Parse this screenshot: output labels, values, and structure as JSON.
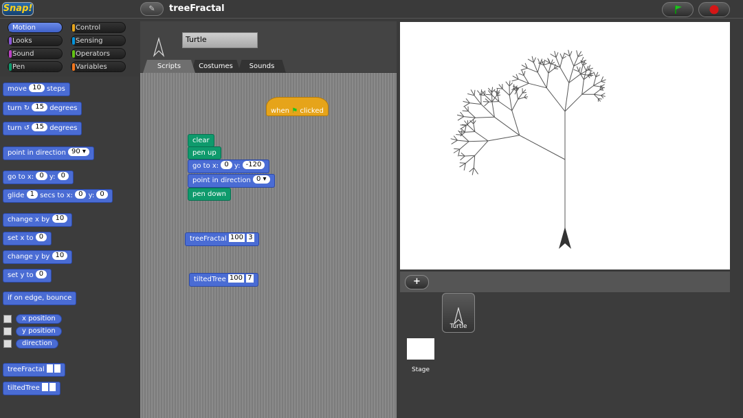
{
  "app": {
    "logo": "Snap!",
    "project_title": "treeFractal"
  },
  "categories": [
    {
      "label": "Motion",
      "color": "#4a6cd4",
      "selected": true
    },
    {
      "label": "Control",
      "color": "#e6a41a"
    },
    {
      "label": "Looks",
      "color": "#8a55d7"
    },
    {
      "label": "Sensing",
      "color": "#0494dc"
    },
    {
      "label": "Sound",
      "color": "#bb42c3"
    },
    {
      "label": "Operators",
      "color": "#62c213"
    },
    {
      "label": "Pen",
      "color": "#0e9a6c"
    },
    {
      "label": "Variables",
      "color": "#f3761d"
    }
  ],
  "palette": {
    "move": {
      "pre": "move",
      "val": "10",
      "post": "steps"
    },
    "turn_cw": {
      "pre": "turn ↻",
      "val": "15",
      "post": "degrees"
    },
    "turn_ccw": {
      "pre": "turn ↺",
      "val": "15",
      "post": "degrees"
    },
    "point_dir": {
      "pre": "point in direction",
      "val": "90 ▾"
    },
    "goto": {
      "pre": "go to x:",
      "x": "0",
      "mid": "y:",
      "y": "0"
    },
    "glide": {
      "pre": "glide",
      "secs": "1",
      "mid": "secs to x:",
      "x": "0",
      "y_lbl": "y:",
      "y": "0"
    },
    "change_x": {
      "pre": "change x by",
      "val": "10"
    },
    "set_x": {
      "pre": "set x to",
      "val": "0"
    },
    "change_y": {
      "pre": "change y by",
      "val": "10"
    },
    "set_y": {
      "pre": "set y to",
      "val": "0"
    },
    "bounce": "if on edge, bounce",
    "reporters": [
      "x position",
      "y position",
      "direction"
    ],
    "custom": [
      "treeFractal",
      "tiltedTree"
    ]
  },
  "sprite": {
    "name": "Turtle"
  },
  "tabs": [
    "Scripts",
    "Costumes",
    "Sounds"
  ],
  "scripts": {
    "hat": {
      "pre": "when",
      "post": "clicked"
    },
    "clear": "clear",
    "pen_up": "pen up",
    "goto": {
      "pre": "go to x:",
      "x": "0",
      "mid": "y:",
      "y": "-120"
    },
    "point_dir": {
      "pre": "point in direction",
      "val": "0 ▾"
    },
    "pen_down": "pen down",
    "tree_fractal": {
      "label": "treeFractal",
      "a": "100",
      "b": "3"
    },
    "tilted_tree": {
      "label": "tiltedTree",
      "a": "100",
      "b": "7"
    }
  },
  "corral": {
    "add": "+",
    "sprite_label": "Turtle",
    "stage_label": "Stage"
  }
}
